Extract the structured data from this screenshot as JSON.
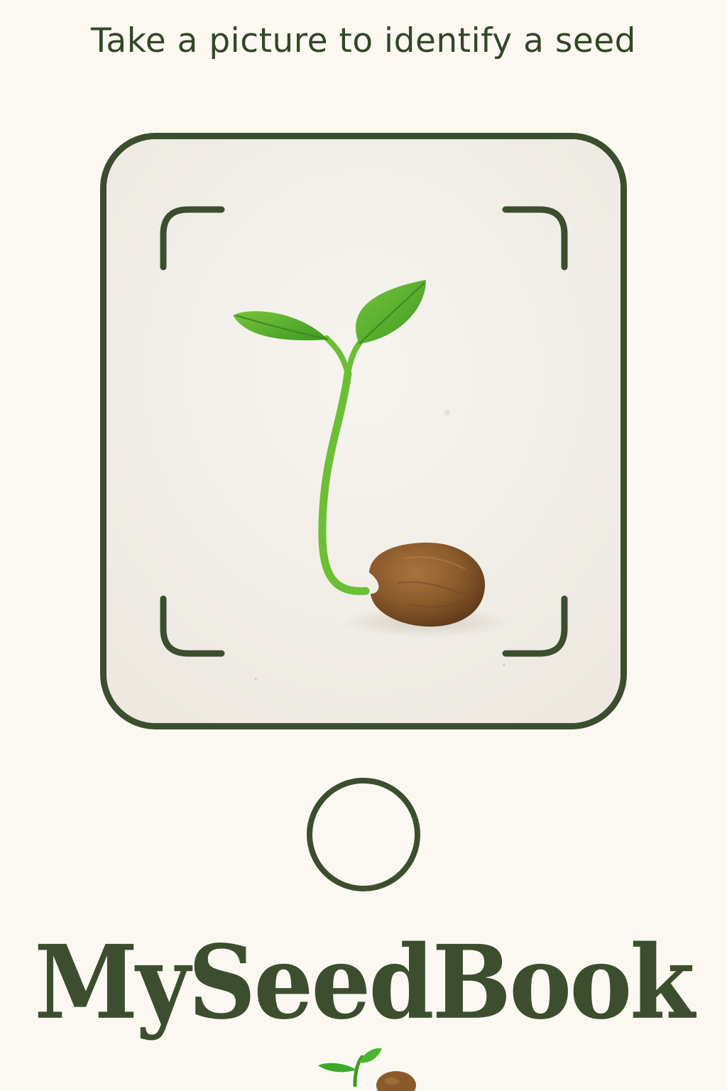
{
  "header": {
    "instruction": "Take a picture to identify a seed"
  },
  "camera": {
    "preview_subject": "seed-sprout-photo",
    "frame_corners": [
      "top-left",
      "top-right",
      "bottom-left",
      "bottom-right"
    ]
  },
  "controls": {
    "shutter_icon": "shutter-button-icon"
  },
  "branding": {
    "app_name": "MySeedBook",
    "logo_icon": "seed-sprout-logo-icon"
  },
  "colors": {
    "background": "#fbf8f2",
    "primary_dark_green": "#3c4e2e",
    "viewfinder_fill": "#f3f0ea",
    "leaf_green": "#5fb32f",
    "seed_brown": "#8b5a2b"
  }
}
